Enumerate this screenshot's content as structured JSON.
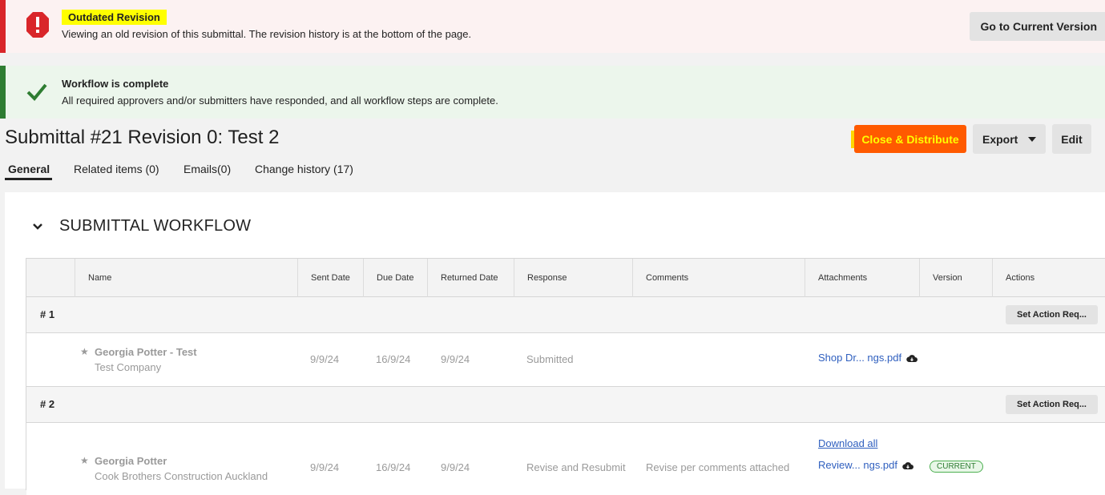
{
  "outdated": {
    "title": "Outdated Revision",
    "message": "Viewing an old revision of this submittal. The revision history is at the bottom of the page.",
    "button": "Go to Current Version",
    "icon": "error-octagon-icon",
    "color": "#d9262a"
  },
  "complete": {
    "title": "Workflow is complete",
    "message": "All required approvers and/or submitters have responded, and all workflow steps are complete.",
    "icon": "check-icon",
    "color": "#2e7d32"
  },
  "header": {
    "title": "Submittal #21 Revision 0: Test 2",
    "close_label": "Close & Distribute",
    "export_label": "Export",
    "edit_label": "Edit"
  },
  "tabs": [
    "General",
    "Related items (0)",
    "Emails(0)",
    "Change history (17)"
  ],
  "section": {
    "title": "SUBMITTAL WORKFLOW"
  },
  "table": {
    "columns": [
      "Name",
      "Sent Date",
      "Due Date",
      "Returned Date",
      "Response",
      "Comments",
      "Attachments",
      "Version",
      "Actions"
    ],
    "groups": [
      {
        "label": "# 1",
        "action": "Set Action Req...",
        "rows": [
          {
            "name": "Georgia Potter - Test",
            "company": "Test Company",
            "sent": "9/9/24",
            "due": "16/9/24",
            "returned": "9/9/24",
            "response": "Submitted",
            "comments": "",
            "attachment": "Shop Dr... ngs.pdf"
          }
        ]
      },
      {
        "label": "# 2",
        "action": "Set Action Req...",
        "rows": [
          {
            "name": "Georgia Potter",
            "company": "Cook Brothers Construction Auckland",
            "sent": "9/9/24",
            "due": "16/9/24",
            "returned": "9/9/24",
            "response": "Revise and Resubmit",
            "comments": "Revise per comments attached",
            "download_all": "Download all",
            "attachment": "Review... ngs.pdf",
            "version": "CURRENT"
          }
        ]
      }
    ]
  },
  "colors": {
    "close_button": "#ff5a00",
    "close_text": "#ffff00",
    "link": "#2f5fbf"
  }
}
